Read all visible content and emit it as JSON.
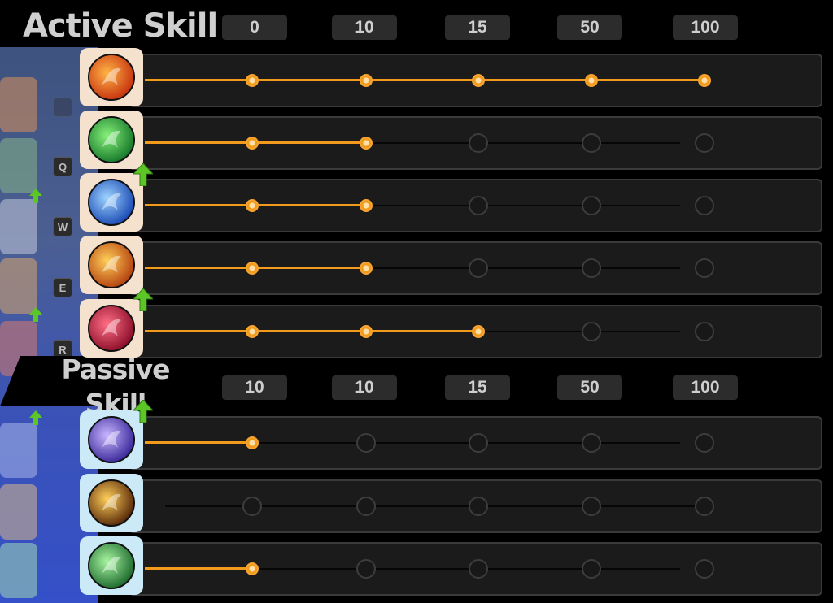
{
  "active_section": {
    "title": "Active Skill",
    "thresholds": [
      "0",
      "10",
      "15",
      "50",
      "100"
    ],
    "skills": [
      {
        "name": "fire-claw-skill",
        "level": 5,
        "upgrade_arrow": false,
        "key": "",
        "colors": [
          "#ffb347",
          "#c7340f"
        ]
      },
      {
        "name": "green-buff-skill",
        "level": 2,
        "upgrade_arrow": true,
        "key": "Q",
        "colors": [
          "#86f07a",
          "#177a2a"
        ]
      },
      {
        "name": "blue-dash-skill",
        "level": 2,
        "upgrade_arrow": false,
        "key": "W",
        "colors": [
          "#9fd4ff",
          "#1b4bb5"
        ]
      },
      {
        "name": "flame-strike-skill",
        "level": 2,
        "upgrade_arrow": true,
        "key": "E",
        "colors": [
          "#ffcf5a",
          "#b5420f"
        ]
      },
      {
        "name": "crimson-spiral-skill",
        "level": 3,
        "upgrade_arrow": false,
        "key": "R",
        "colors": [
          "#ff6f86",
          "#8d0f2a"
        ]
      }
    ]
  },
  "passive_section": {
    "title_line1": "Passive",
    "title_line2": "Skill",
    "thresholds": [
      "10",
      "10",
      "15",
      "50",
      "100"
    ],
    "skills": [
      {
        "name": "lightning-passive",
        "level": 1,
        "upgrade_arrow": true,
        "colors": [
          "#c9b6ff",
          "#3b2a9b"
        ]
      },
      {
        "name": "orb-passive",
        "level": 0,
        "upgrade_arrow": false,
        "colors": [
          "#ffcf5a",
          "#5a2a0a"
        ]
      },
      {
        "name": "leaf-passive",
        "level": 1,
        "upgrade_arrow": false,
        "colors": [
          "#a6f5a0",
          "#1f6a2f"
        ]
      }
    ]
  },
  "colors": {
    "progress": "#f29a1b",
    "active_frame": "#f4e2cf",
    "passive_frame": "#cbe9f7",
    "upgrade_arrow": "#5cc626"
  }
}
